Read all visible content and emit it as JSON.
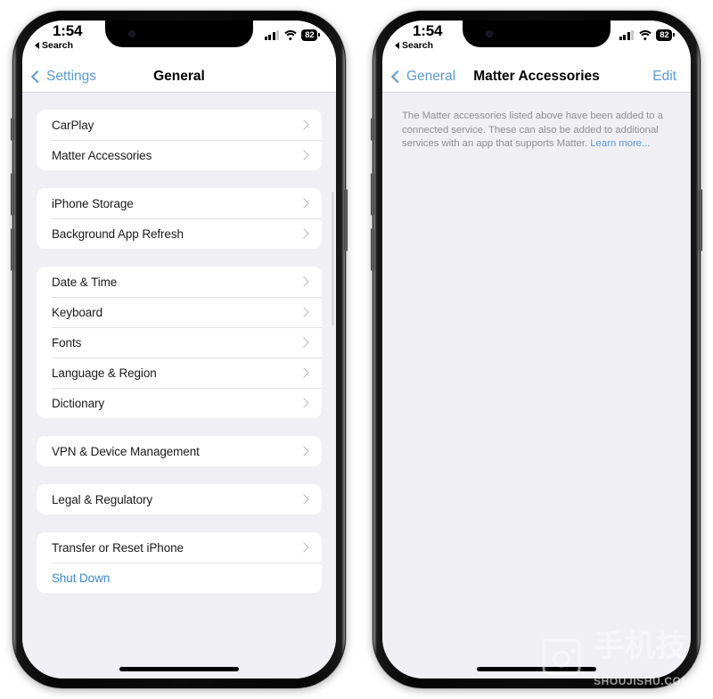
{
  "colors": {
    "accent": "#5a9bd8",
    "group_bg": "#f0f0f4",
    "row_bg": "#ffffff",
    "chevron": "#b9b9bf",
    "footnote": "#8e8e93"
  },
  "phone_left": {
    "status_bar": {
      "time": "1:54",
      "back_app": "Search",
      "battery_percent": "82",
      "signal_icon": "cellular-signal-icon",
      "wifi_icon": "wifi-icon",
      "battery_icon": "battery-icon"
    },
    "nav": {
      "back_label": "Settings",
      "title": "General",
      "back_icon": "chevron-left-icon"
    },
    "groups": [
      {
        "rows": [
          {
            "label": "CarPlay",
            "accessory": "chevron-right-icon"
          },
          {
            "label": "Matter Accessories",
            "accessory": "chevron-right-icon"
          }
        ]
      },
      {
        "rows": [
          {
            "label": "iPhone Storage",
            "accessory": "chevron-right-icon"
          },
          {
            "label": "Background App Refresh",
            "accessory": "chevron-right-icon"
          }
        ]
      },
      {
        "rows": [
          {
            "label": "Date & Time",
            "accessory": "chevron-right-icon"
          },
          {
            "label": "Keyboard",
            "accessory": "chevron-right-icon"
          },
          {
            "label": "Fonts",
            "accessory": "chevron-right-icon"
          },
          {
            "label": "Language & Region",
            "accessory": "chevron-right-icon"
          },
          {
            "label": "Dictionary",
            "accessory": "chevron-right-icon"
          }
        ]
      },
      {
        "rows": [
          {
            "label": "VPN & Device Management",
            "accessory": "chevron-right-icon"
          }
        ]
      },
      {
        "rows": [
          {
            "label": "Legal & Regulatory",
            "accessory": "chevron-right-icon"
          }
        ]
      },
      {
        "rows": [
          {
            "label": "Transfer or Reset iPhone",
            "accessory": "chevron-right-icon"
          },
          {
            "label": "Shut Down",
            "accessory": "none",
            "style": "blue"
          }
        ]
      }
    ]
  },
  "phone_right": {
    "status_bar": {
      "time": "1:54",
      "back_app": "Search",
      "battery_percent": "82",
      "signal_icon": "cellular-signal-icon",
      "wifi_icon": "wifi-icon",
      "battery_icon": "battery-icon"
    },
    "nav": {
      "back_label": "General",
      "title": "Matter Accessories",
      "action_label": "Edit",
      "back_icon": "chevron-left-icon"
    },
    "footnote": {
      "text": "The Matter accessories listed above have been added to a connected service. These can also be added to additional services with an app that supports Matter. ",
      "link": "Learn more..."
    }
  },
  "watermark": {
    "cn": "手机技",
    "en": "SHOUJISHU.COM",
    "logo_icon": "camera-phone-logo-icon"
  }
}
